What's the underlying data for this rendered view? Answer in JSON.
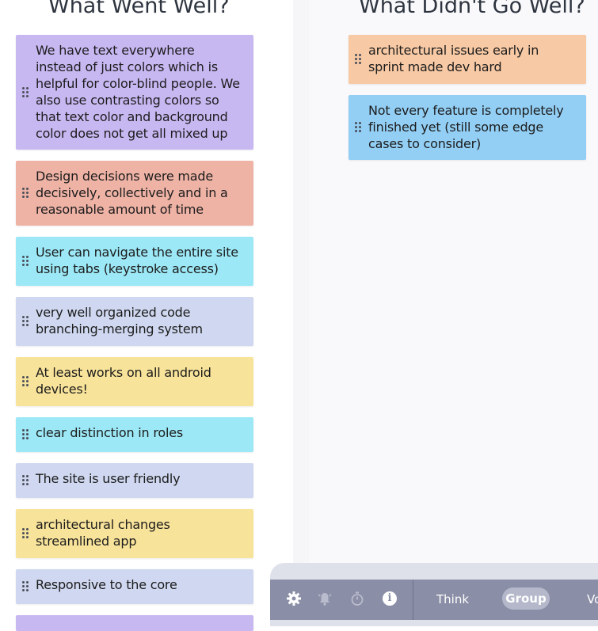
{
  "columns": {
    "went_well": {
      "title": "What Went Well?",
      "cards": [
        {
          "text": "We have text everywhere instead of just colors which is helpful for color-blind people. We also use contrasting colors so that text color and background color does not get all mixed up",
          "color": "#c8b8f2"
        },
        {
          "text": "Design decisions were made decisively, collectively and in a reasonable amount of time",
          "color": "#efb3a6"
        },
        {
          "text": "User can navigate the entire site using tabs (keystroke access)",
          "color": "#9ce8f6"
        },
        {
          "text": "very well organized code branching-merging system",
          "color": "#cfd8f0"
        },
        {
          "text": "At least works on all android devices!",
          "color": "#f8e39a"
        },
        {
          "text": "clear distinction in roles",
          "color": "#9ce8f6"
        },
        {
          "text": "The site is user friendly",
          "color": "#cfd8f0"
        },
        {
          "text": "architectural changes streamlined app",
          "color": "#f8e39a"
        },
        {
          "text": "Responsive to the core",
          "color": "#cfd8f0"
        }
      ]
    },
    "didnt_go_well": {
      "title": "What Didn't Go Well?",
      "cards": [
        {
          "text": "architectural issues early in sprint made dev hard",
          "color": "#f7c9a4"
        },
        {
          "text": "Not every feature is completely finished yet (still some edge cases to consider)",
          "color": "#93cff5"
        }
      ]
    }
  },
  "toolbar": {
    "icons": [
      "gear-icon",
      "alarm-bell-icon",
      "stopwatch-icon",
      "info-icon"
    ],
    "phases": [
      "Think",
      "Group",
      "Vo"
    ],
    "active_phase": "Group"
  }
}
